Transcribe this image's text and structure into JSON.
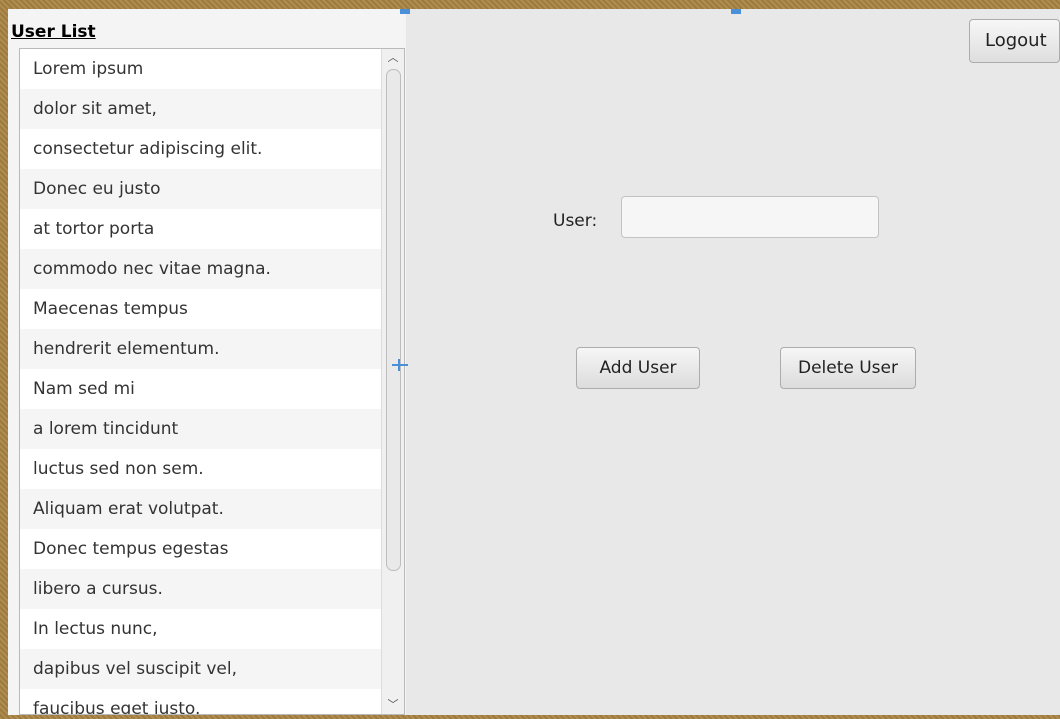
{
  "user_list": {
    "title": "User List",
    "items": [
      "Lorem ipsum",
      "dolor sit amet,",
      "consectetur adipiscing elit.",
      "Donec eu justo",
      "at tortor porta",
      "commodo nec vitae magna.",
      "Maecenas tempus",
      "hendrerit elementum.",
      "Nam sed mi",
      "a lorem tincidunt",
      "luctus sed non sem.",
      "Aliquam erat volutpat.",
      "Donec tempus egestas",
      "libero a cursus.",
      "In lectus nunc,",
      "dapibus vel suscipit vel,",
      "faucibus eget justo."
    ],
    "scroll_up_icon": "chevron-up-icon",
    "scroll_down_icon": "chevron-down-icon"
  },
  "form": {
    "user_label": "User:",
    "user_value": "",
    "add_label": "Add User",
    "delete_label": "Delete User"
  },
  "header": {
    "logout_label": "Logout"
  },
  "colors": {
    "frame": "#a8864a",
    "background": "#e8e8e8",
    "accent": "#4a90d9"
  }
}
